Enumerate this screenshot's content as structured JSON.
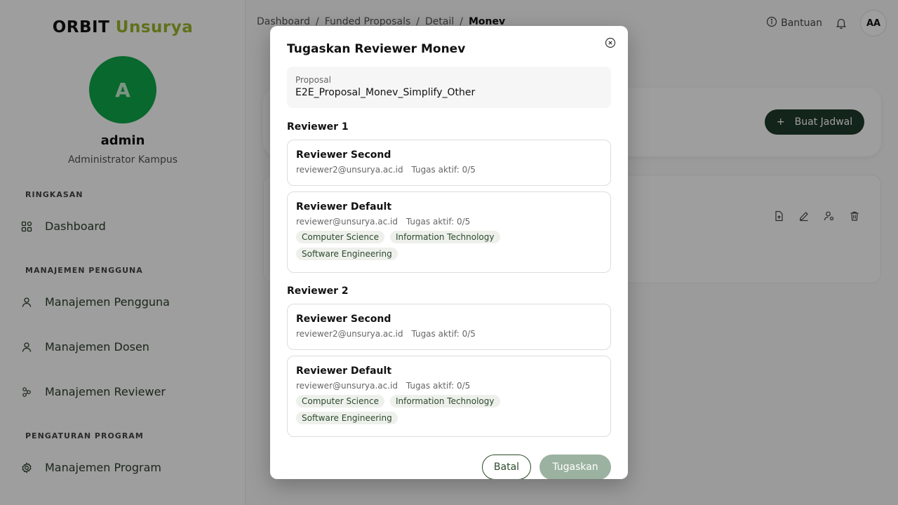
{
  "brand": {
    "part1": "ORBIT",
    "part2": "Unsurya"
  },
  "user": {
    "initial": "A",
    "name": "admin",
    "role": "Administrator Kampus"
  },
  "sidebar": {
    "sections": [
      {
        "label": "RINGKASAN"
      },
      {
        "label": "MANAJEMEN PENGGUNA"
      },
      {
        "label": "PENGATURAN PROGRAM"
      }
    ],
    "items": [
      {
        "label": "Dashboard",
        "icon": "grid-icon"
      },
      {
        "label": "Manajemen Pengguna",
        "icon": "user-icon"
      },
      {
        "label": "Manajemen Dosen",
        "icon": "user-icon"
      },
      {
        "label": "Manajemen Reviewer",
        "icon": "users-network-icon"
      },
      {
        "label": "Manajemen Program",
        "icon": "gear-icon"
      }
    ]
  },
  "breadcrumb": [
    "Dashboard",
    "Funded Proposals",
    "Detail",
    "Monev"
  ],
  "breadcrumb_sep": "/",
  "topbar": {
    "help_label": "Bantuan",
    "avatar_initials": "AA"
  },
  "main": {
    "create_schedule_label": "Buat Jadwal",
    "plus": "+"
  },
  "modal": {
    "title": "Tugaskan Reviewer Monev",
    "proposal_label": "Proposal",
    "proposal_value": "E2E_Proposal_Monev_Simplify_Other",
    "reviewer1_heading": "Reviewer 1",
    "reviewer2_heading": "Reviewer 2",
    "r1": [
      {
        "name": "Reviewer Second",
        "email": "reviewer2@unsurya.ac.id",
        "tasks": "Tugas aktif: 0/5",
        "tags": []
      },
      {
        "name": "Reviewer Default",
        "email": "reviewer@unsurya.ac.id",
        "tasks": "Tugas aktif: 0/5",
        "tags": [
          "Computer Science",
          "Information Technology",
          "Software Engineering"
        ]
      }
    ],
    "r2": [
      {
        "name": "Reviewer Second",
        "email": "reviewer2@unsurya.ac.id",
        "tasks": "Tugas aktif: 0/5",
        "tags": []
      },
      {
        "name": "Reviewer Default",
        "email": "reviewer@unsurya.ac.id",
        "tasks": "Tugas aktif: 0/5",
        "tags": [
          "Computer Science",
          "Information Technology",
          "Software Engineering"
        ]
      }
    ],
    "cancel_label": "Batal",
    "submit_label": "Tugaskan"
  },
  "colors": {
    "brand_accent": "#9ab62c",
    "avatar_green": "#0fa84a",
    "primary_dark": "#1f3b2a",
    "submit_disabled": "#9bb2a0"
  }
}
